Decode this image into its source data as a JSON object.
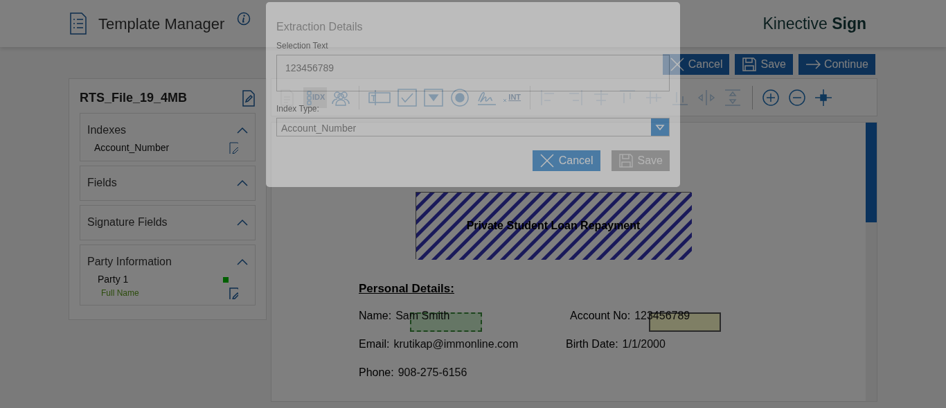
{
  "header": {
    "title": "Template Manager",
    "brand": "Kinective **Sign**"
  },
  "actions": [
    {
      "label": "Cancel",
      "kind": "cancel"
    },
    {
      "label": "Save",
      "kind": "save"
    },
    {
      "label": "Continue",
      "kind": "continue"
    }
  ],
  "template": {
    "name": "RTS_File_19_4MB",
    "sections": [
      {
        "title": "Indexes",
        "expanded": true,
        "items": [
          {
            "label": "Account_Number"
          }
        ]
      },
      {
        "title": "Fields",
        "expanded": true
      },
      {
        "title": "Signature Fields",
        "expanded": true
      },
      {
        "title": "Party Information",
        "expanded": true,
        "items": [
          {
            "label": "Party 1",
            "children": [
              {
                "label": "Full Name"
              }
            ]
          }
        ]
      }
    ]
  },
  "toolbar": {
    "tools": [
      {
        "kind": "doc",
        "selected": false,
        "disabled": true
      },
      {
        "kind": "idx",
        "label": "IDX",
        "selected": true,
        "disabled": false
      },
      {
        "kind": "people",
        "selected": false,
        "disabled": false
      },
      {
        "kind": "sep"
      },
      {
        "kind": "textbox",
        "selected": false,
        "disabled": false
      },
      {
        "kind": "checkbox",
        "selected": false,
        "disabled": false
      },
      {
        "kind": "dropdown",
        "selected": false,
        "disabled": false
      },
      {
        "kind": "radio",
        "selected": false,
        "disabled": false
      },
      {
        "kind": "signature",
        "selected": false,
        "disabled": false
      },
      {
        "kind": "int",
        "label": "INT",
        "selected": false,
        "disabled": false
      },
      {
        "kind": "sep"
      },
      {
        "kind": "align-left",
        "selected": false,
        "disabled": true
      },
      {
        "kind": "align-right",
        "selected": false,
        "disabled": true
      },
      {
        "kind": "align-center",
        "selected": false,
        "disabled": true
      },
      {
        "kind": "align-top",
        "selected": false,
        "disabled": true
      },
      {
        "kind": "align-middle",
        "selected": false,
        "disabled": true
      },
      {
        "kind": "align-bottom",
        "selected": false,
        "disabled": true
      },
      {
        "kind": "space-h",
        "selected": false,
        "disabled": true
      },
      {
        "kind": "space-v",
        "selected": false,
        "disabled": true
      },
      {
        "kind": "sep"
      },
      {
        "kind": "zoom-in",
        "selected": false,
        "disabled": false
      },
      {
        "kind": "zoom-out",
        "selected": false,
        "disabled": false
      },
      {
        "kind": "crosshair",
        "selected": false,
        "disabled": false
      }
    ]
  },
  "document": {
    "heading": "Private Student Loan Repayment",
    "section": "Personal Details:",
    "lines": [
      [
        {
          "kind": "party_field",
          "label": "Name:",
          "value": "Sam Smith"
        },
        {
          "kind": "index_field",
          "label": "Account No:",
          "value": "123456789"
        }
      ],
      [
        {
          "kind": "plain",
          "label": "Email:",
          "value": "krutikap@immonline.com"
        },
        {
          "kind": "plain",
          "label": "Birth Date:",
          "value": "1/1/2000"
        }
      ],
      [
        {
          "kind": "plain",
          "label": "Phone:",
          "value": "908-275-6156"
        }
      ]
    ]
  },
  "modal": {
    "title": "Extraction Details",
    "selection_label": "Selection Text",
    "selection_value": "123456789",
    "index_label": "Index Type:",
    "index_value": "Account_Number",
    "buttons": [
      {
        "label": "Cancel",
        "kind": "cancel",
        "disabled": false
      },
      {
        "label": "Save",
        "kind": "save",
        "disabled": true
      }
    ]
  }
}
